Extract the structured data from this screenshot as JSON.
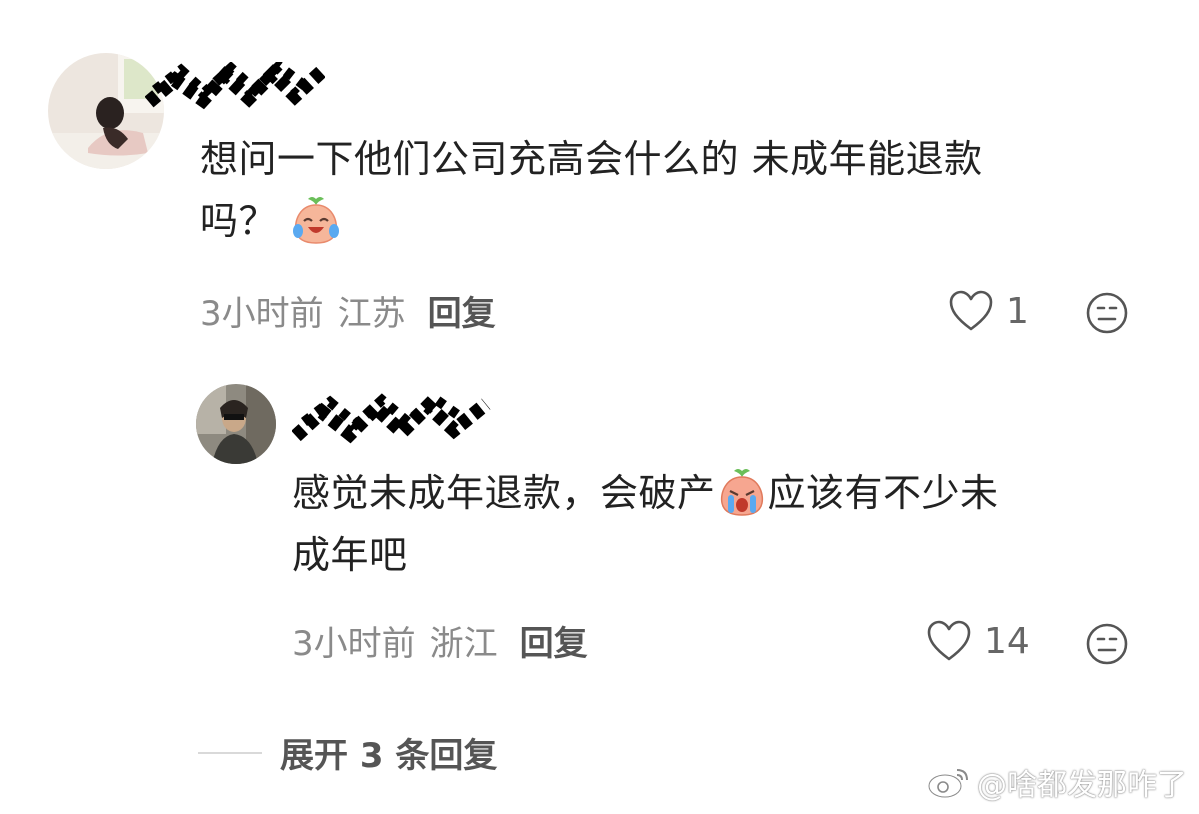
{
  "comments": [
    {
      "avatar": "girl-photo-avatar",
      "username_obscured": true,
      "text_line1": "想问一下他们公司充高会什么的 未成年能退款",
      "text_line2": "吗？",
      "emoji": "crying-laugh-peach-emoji",
      "time": "3小时前",
      "location": "江苏",
      "reply_label": "回复",
      "likes": "1"
    },
    {
      "avatar": "man-photo-avatar",
      "username_obscured": true,
      "text_part1": "感觉未成年退款，会破产",
      "emoji": "crying-peach-emoji",
      "text_part2": "应该有不少未",
      "text_line2": "成年吧",
      "time": "3小时前",
      "location": "浙江",
      "reply_label": "回复",
      "likes": "14"
    }
  ],
  "expand_replies": "展开 3 条回复",
  "watermark": "@啥都发那咋了",
  "colors": {
    "text": "#222222",
    "meta": "#8a8a8a",
    "reply": "#555555"
  }
}
